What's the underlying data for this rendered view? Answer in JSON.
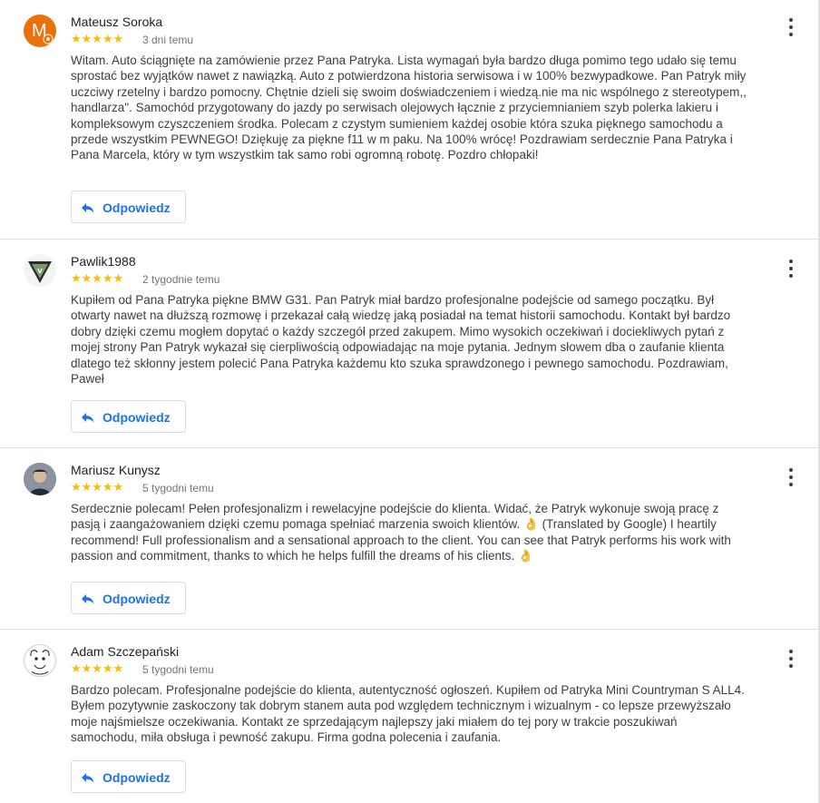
{
  "reviews": [
    {
      "name": "Mateusz Soroka",
      "avatar_letter": "M",
      "avatar_color": "#e8710a",
      "stars": "★★★★★",
      "rating": 5,
      "time": "3 dni temu",
      "text": "Witam. Auto ściągnięte na zamówienie przez Pana Patryka. Lista wymagań była bardzo długa pomimo tego udało się temu sprostać bez wyjątków nawet z nawiązką. Auto z potwierdzona historia serwisowa i w 100% bezwypadkowe. Pan Patryk miły uczciwy rzetelny i bardzo pomocny. Chętnie dzieli się swoim doświadczeniem i wiedzą.nie ma nic wspólnego z stereotypem,, handlarza\". Samochód przygotowany do jazdy po serwisach olejowych łącznie z przyciemnianiem szyb polerka lakieru i kompleksowym czyszczeniem środka. Polecam z czystym sumieniem każdej osobie która szuka pięknego samochodu a przede wszystkim PEWNEGO! Dziękuję za piękne f11 w m paku. Na 100% wrócę! Pozdrawiam serdecznie Pana Patryka i Pana Marcela, który w tym wszystkim tak samo robi ogromną robotę. Pozdro chłopaki!",
      "reply_label": "Odpowiedz"
    },
    {
      "name": "Pawlik1988",
      "stars": "★★★★★",
      "rating": 5,
      "time": "2 tygodnie temu",
      "text": "Kupiłem od Pana Patryka piękne BMW G31. Pan Patryk miał bardzo profesjonalne podejście od samego początku. Był otwarty nawet na dłuższą rozmowę i przekazał całą wiedzę jaką posiadał na temat historii samochodu. Kontakt był bardzo dobry dzięki czemu mogłem dopytać o każdy szczegół przed zakupem. Mimo wysokich oczekiwań i dociekliwych pytań z mojej strony Pan Patryk wykazał się cierpliwością odpowiadając na moje pytania. Jednym słowem dba o zaufanie klienta dlatego też skłonny jestem polecić Pana Patryka każdemu kto szuka sprawdzonego i pewnego samochodu. Pozdrawiam, Paweł",
      "reply_label": "Odpowiedz"
    },
    {
      "name": "Mariusz Kunysz",
      "stars": "★★★★★",
      "rating": 5,
      "time": "5 tygodni temu",
      "text": "Serdecznie polecam! Pełen profesjonalizm i rewelacyjne podejście do klienta. Widać, że Patryk wykonuje swoją pracę z pasją i zaangażowaniem dzięki czemu pomaga spełniać marzenia swoich klientów. 👌 (Translated by Google) I heartily recommend! Full professionalism and a sensational approach to the client. You can see that Patryk performs his work with passion and commitment, thanks to which he helps fulfill the dreams of his clients. 👌",
      "reply_label": "Odpowiedz"
    },
    {
      "name": "Adam Szczepański",
      "stars": "★★★★★",
      "rating": 5,
      "time": "5 tygodni temu",
      "text": "Bardzo polecam. Profesjonalne podejście do klienta, autentyczność ogłoszeń. Kupiłem od Patryka Mini Countryman S ALL4. Byłem pozytywnie zaskoczony tak dobrym stanem auta pod względem technicznym i wizualnym - co lepsze przewyższało moje najśmielsze oczekiwania. Kontakt ze sprzedającym najlepszy jaki miałem do tej pory w trakcie poszukiwań samochodu, miła obsługa i pewność zakupu. Firma godna polecenia i zaufania.",
      "reply_label": "Odpowiedz"
    }
  ],
  "colors": {
    "star": "#fbbc04",
    "link": "#1a73e8",
    "divider": "#e0e0e0"
  }
}
